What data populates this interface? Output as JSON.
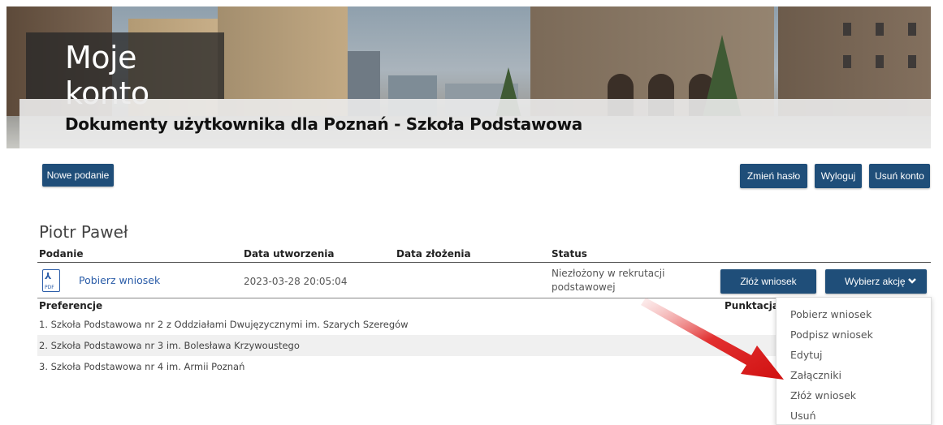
{
  "banner": {
    "title": "Moje konto",
    "subtitle": "Dokumenty użytkownika dla Poznań - Szkoła Podstawowa"
  },
  "toolbar": {
    "new_submission_label": "Nowe podanie",
    "change_password_label": "Zmień hasło",
    "logout_label": "Wyloguj",
    "delete_account_label": "Usuń konto"
  },
  "user": {
    "name": "Piotr Paweł"
  },
  "table": {
    "headers": {
      "submission": "Podanie",
      "created": "Data utworzenia",
      "submitted": "Data złożenia",
      "status": "Status"
    },
    "row": {
      "link": "Pobierz wniosek",
      "created": "2023-03-28 20:05:04",
      "submitted": "",
      "status_line1": "Niezłożony w rekrutacji",
      "status_line2": "podstawowej",
      "submit_button": "Złóż wniosek",
      "action_button": "Wybierz akcję"
    },
    "preferences_header": "Preferencje",
    "points_header": "Punktacja",
    "preferences": [
      "1. Szkoła Podstawowa nr 2 z Oddziałami Dwujęzycznymi im. Szarych Szeregów",
      "2. Szkoła Podstawowa nr 3 im. Bolesława Krzywoustego",
      "3. Szkoła Podstawowa nr 4 im. Armii Poznań"
    ]
  },
  "dropdown": {
    "items": [
      "Pobierz wniosek",
      "Podpisz wniosek",
      "Edytuj",
      "Załączniki",
      "Złóż wniosek",
      "Usuń"
    ]
  },
  "icons": {
    "pdf": "pdf-file-icon",
    "chevron": "chevron-down-icon",
    "arrow": "red-arrow-annotation"
  },
  "colors": {
    "button": "#1f4e79",
    "link": "#2a5ca8",
    "arrow": "#e02020"
  }
}
